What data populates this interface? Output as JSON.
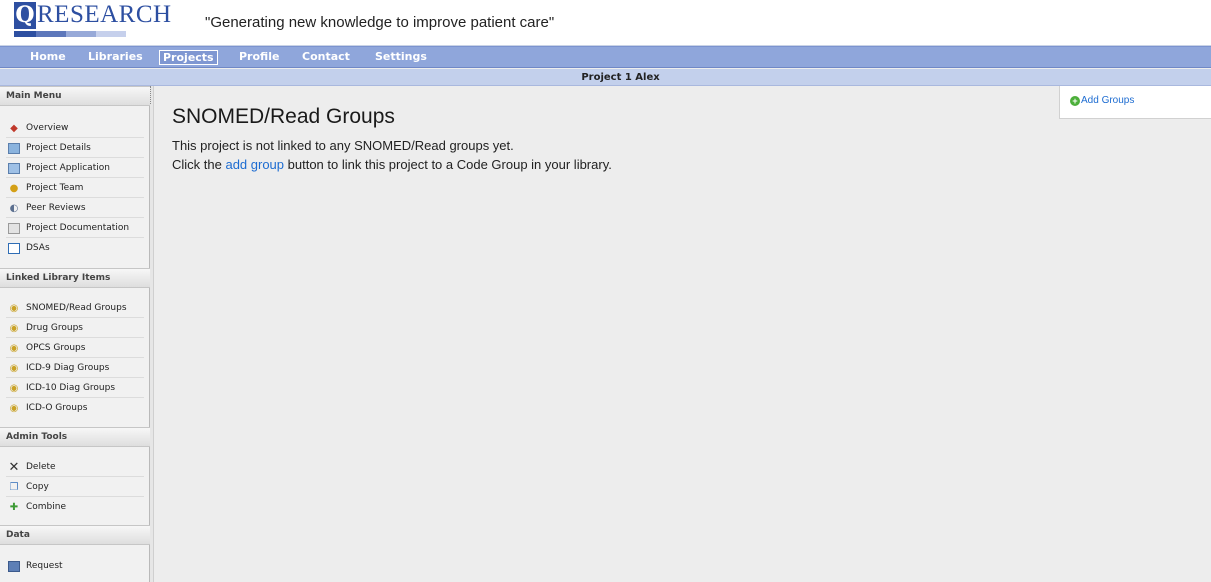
{
  "header": {
    "logo_q": "Q",
    "logo_text": "RESEARCH",
    "tagline": "\"Generating new knowledge to improve patient care\""
  },
  "nav": {
    "items": [
      "Home",
      "Libraries",
      "Projects",
      "Profile",
      "Contact",
      "Settings"
    ],
    "active": "Projects"
  },
  "project_bar": {
    "title": "Project 1 Alex"
  },
  "sidebar": {
    "sections": {
      "main_menu": "Main Menu",
      "linked_library": "Linked Library Items",
      "admin_tools": "Admin Tools",
      "data": "Data"
    },
    "main_menu": [
      {
        "label": "Overview",
        "icon": "overview-icon"
      },
      {
        "label": "Project Details",
        "icon": "project-details-icon"
      },
      {
        "label": "Project Application",
        "icon": "project-application-icon"
      },
      {
        "label": "Project Team",
        "icon": "team-icon"
      },
      {
        "label": "Peer Reviews",
        "icon": "peer-review-icon"
      },
      {
        "label": "Project Documentation",
        "icon": "document-icon"
      },
      {
        "label": "DSAs",
        "icon": "dsa-icon"
      }
    ],
    "linked_library": [
      {
        "label": "SNOMED/Read Groups",
        "icon": "code-group-icon"
      },
      {
        "label": "Drug Groups",
        "icon": "code-group-icon"
      },
      {
        "label": "OPCS Groups",
        "icon": "code-group-icon"
      },
      {
        "label": "ICD-9 Diag Groups",
        "icon": "code-group-icon"
      },
      {
        "label": "ICD-10 Diag Groups",
        "icon": "code-group-icon"
      },
      {
        "label": "ICD-O Groups",
        "icon": "code-group-icon"
      }
    ],
    "admin_tools": [
      {
        "label": "Delete",
        "icon": "delete-icon"
      },
      {
        "label": "Copy",
        "icon": "copy-icon"
      },
      {
        "label": "Combine",
        "icon": "combine-icon"
      }
    ],
    "data": [
      {
        "label": "Request",
        "icon": "request-icon"
      }
    ]
  },
  "content": {
    "title": "SNOMED/Read Groups",
    "line1": "This project is not linked to any SNOMED/Read groups yet.",
    "line2_before": "Click the ",
    "line2_link": "add group",
    "line2_after": " button to link this project to a Code Group in your library."
  },
  "right_panel": {
    "add_groups": "Add Groups"
  },
  "colors": {
    "nav_bg": "#8fa6db",
    "project_bar_bg": "#c3d0ec",
    "link": "#1d6cd1",
    "logo_blue": "#2d4fa1"
  }
}
